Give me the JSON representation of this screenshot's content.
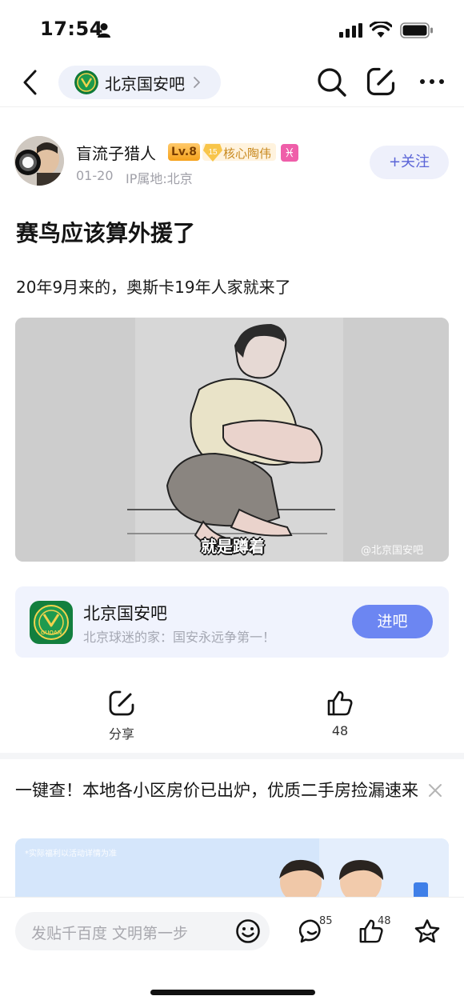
{
  "status_bar": {
    "time": "17:54",
    "icons": [
      "person-icon",
      "signal-icon",
      "wifi-icon",
      "battery-icon"
    ]
  },
  "nav": {
    "forum_name": "北京国安吧",
    "icons": [
      "back-icon",
      "chevron-right-icon",
      "search-icon",
      "edit-icon",
      "more-icon"
    ]
  },
  "author": {
    "name": "盲流子猎人",
    "level": "Lv.8",
    "core_badge_level": "15",
    "core_badge_label": "核心陶伟",
    "zodiac_symbol": "♓",
    "date": "01-20",
    "ip_location": "IP属地:北京",
    "follow_label": "+关注"
  },
  "post": {
    "title": "赛鸟应该算外援了",
    "body": "20年9月来的，奥斯卡19年人家就来了",
    "image_caption": "就是蹲着",
    "image_watermark": "@北京国安吧"
  },
  "forum_card": {
    "name": "北京国安吧",
    "slogan": "北京球迷的家：国安永远争第一！",
    "logo_text": "GUOAN",
    "enter_label": "进吧"
  },
  "actions": {
    "share_label": "分享",
    "like_count": "48"
  },
  "ad": {
    "title": "一键查！本地各小区房价已出炉，优质二手房捡漏速来",
    "disclaimer": "*实际福利以活动详情为准"
  },
  "bottom_bar": {
    "comment_placeholder": "发贴千百度 文明第一步",
    "comment_count": "85",
    "like_count": "48"
  },
  "colors": {
    "accent": "#5a64d7",
    "enter_button": "#6c86f2",
    "forum_card_bg": "#f0f3fd",
    "level_badge": "#f6a21c",
    "zodiac_badge": "#ef5ea9"
  }
}
